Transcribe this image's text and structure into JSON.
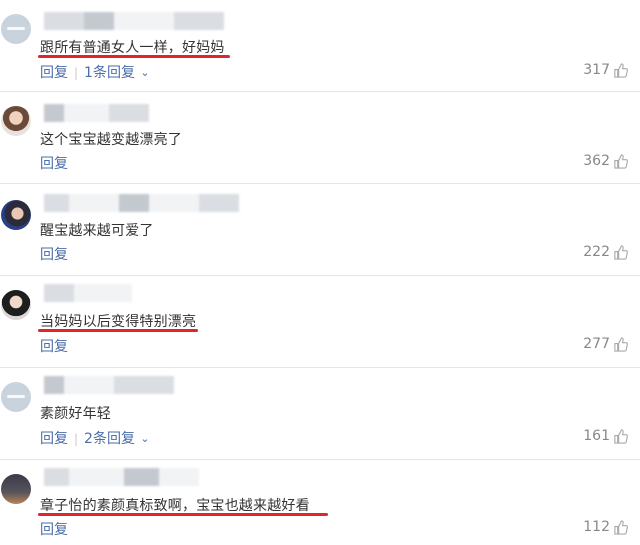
{
  "comments": [
    {
      "text": "跟所有普通女人一样，好妈妈",
      "reply_label": "回复",
      "replies_label": "1条回复",
      "likes": "317",
      "highlighted": true
    },
    {
      "text": "这个宝宝越变越漂亮了",
      "reply_label": "回复",
      "likes": "362",
      "highlighted": false
    },
    {
      "text": "醒宝越来越可爱了",
      "reply_label": "回复",
      "likes": "222",
      "highlighted": false
    },
    {
      "text": "当妈妈以后变得特别漂亮",
      "reply_label": "回复",
      "likes": "277",
      "highlighted": true
    },
    {
      "text": "素颜好年轻",
      "reply_label": "回复",
      "replies_label": "2条回复",
      "likes": "161",
      "highlighted": false
    },
    {
      "text": "章子怡的素颜真标致啊，宝宝也越来越好看",
      "reply_label": "回复",
      "likes": "112",
      "highlighted": true
    }
  ],
  "icons": {
    "like": "thumbs-up-icon",
    "expand": "chevron-down-icon"
  },
  "colors": {
    "link": "#4a6ea8",
    "highlight_underline": "#e0252b",
    "muted": "#888888"
  }
}
